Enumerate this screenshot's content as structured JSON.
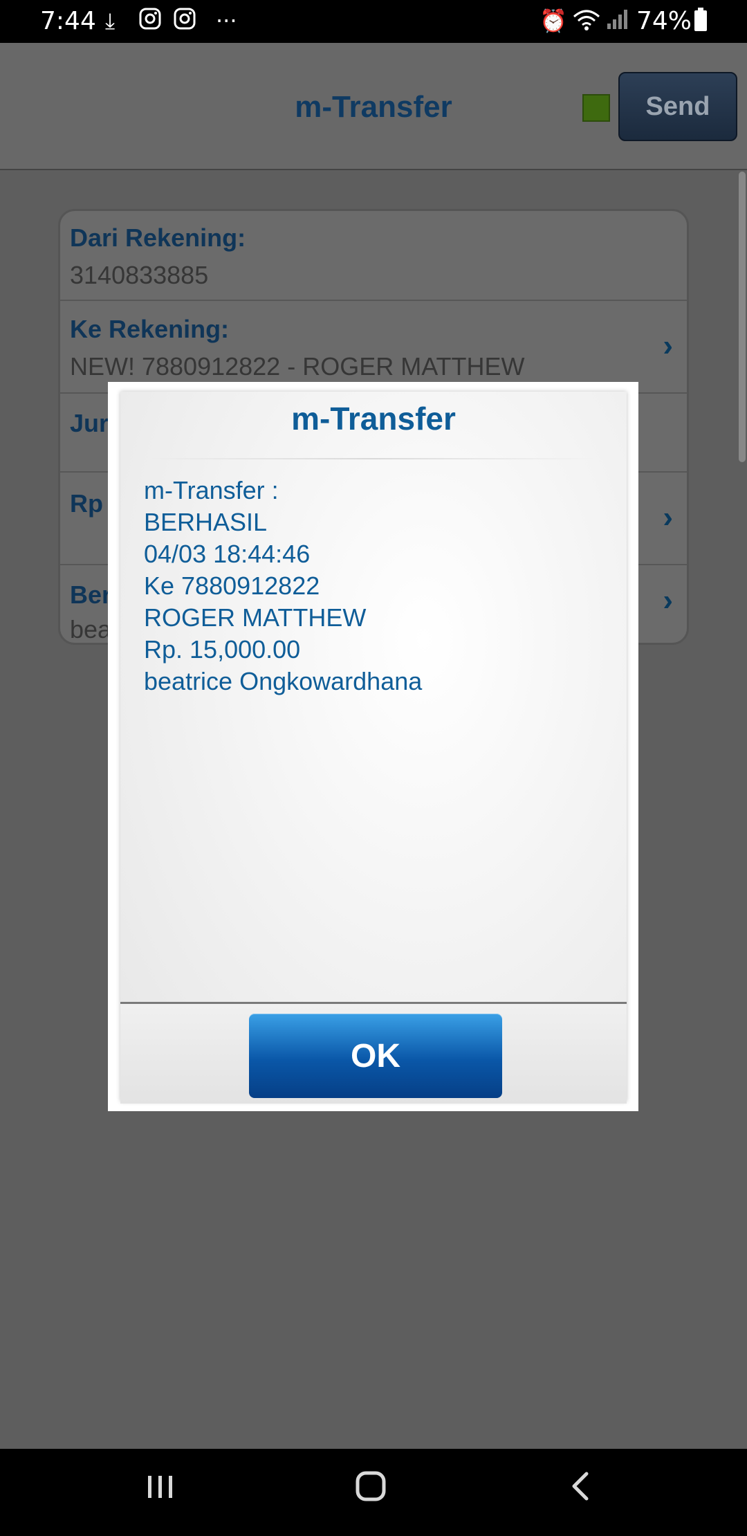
{
  "status_bar": {
    "time": "7:44",
    "battery_text": "74%",
    "icons": [
      "download-icon",
      "instagram-icon",
      "instagram-icon",
      "more-dots-icon",
      "alarm-icon",
      "wifi-icon",
      "signal-icon",
      "battery-icon"
    ]
  },
  "app_bar": {
    "title": "m-Transfer",
    "send_label": "Send",
    "status_color": "#3e6a0f"
  },
  "form": {
    "rows": [
      {
        "label": "Dari Rekening:",
        "value": "3140833885"
      },
      {
        "label": "Ke Rekening:",
        "value": "NEW! 7880912822 - ROGER MATTHEW"
      },
      {
        "label": "Jur",
        "value": ""
      },
      {
        "label": "Rp",
        "value": ""
      },
      {
        "label": "Ber",
        "value": "bea"
      }
    ]
  },
  "dialog": {
    "title": "m-Transfer",
    "lines": [
      "m-Transfer :",
      "BERHASIL",
      "04/03 18:44:46",
      "Ke 7880912822",
      "ROGER MATTHEW",
      "Rp. 15,000.00",
      "beatrice Ongkowardhana"
    ],
    "ok_label": "OK",
    "accent": "#0f5d98"
  },
  "nav_bar": {
    "icons": [
      "recent-apps-icon",
      "home-icon",
      "back-icon"
    ]
  }
}
